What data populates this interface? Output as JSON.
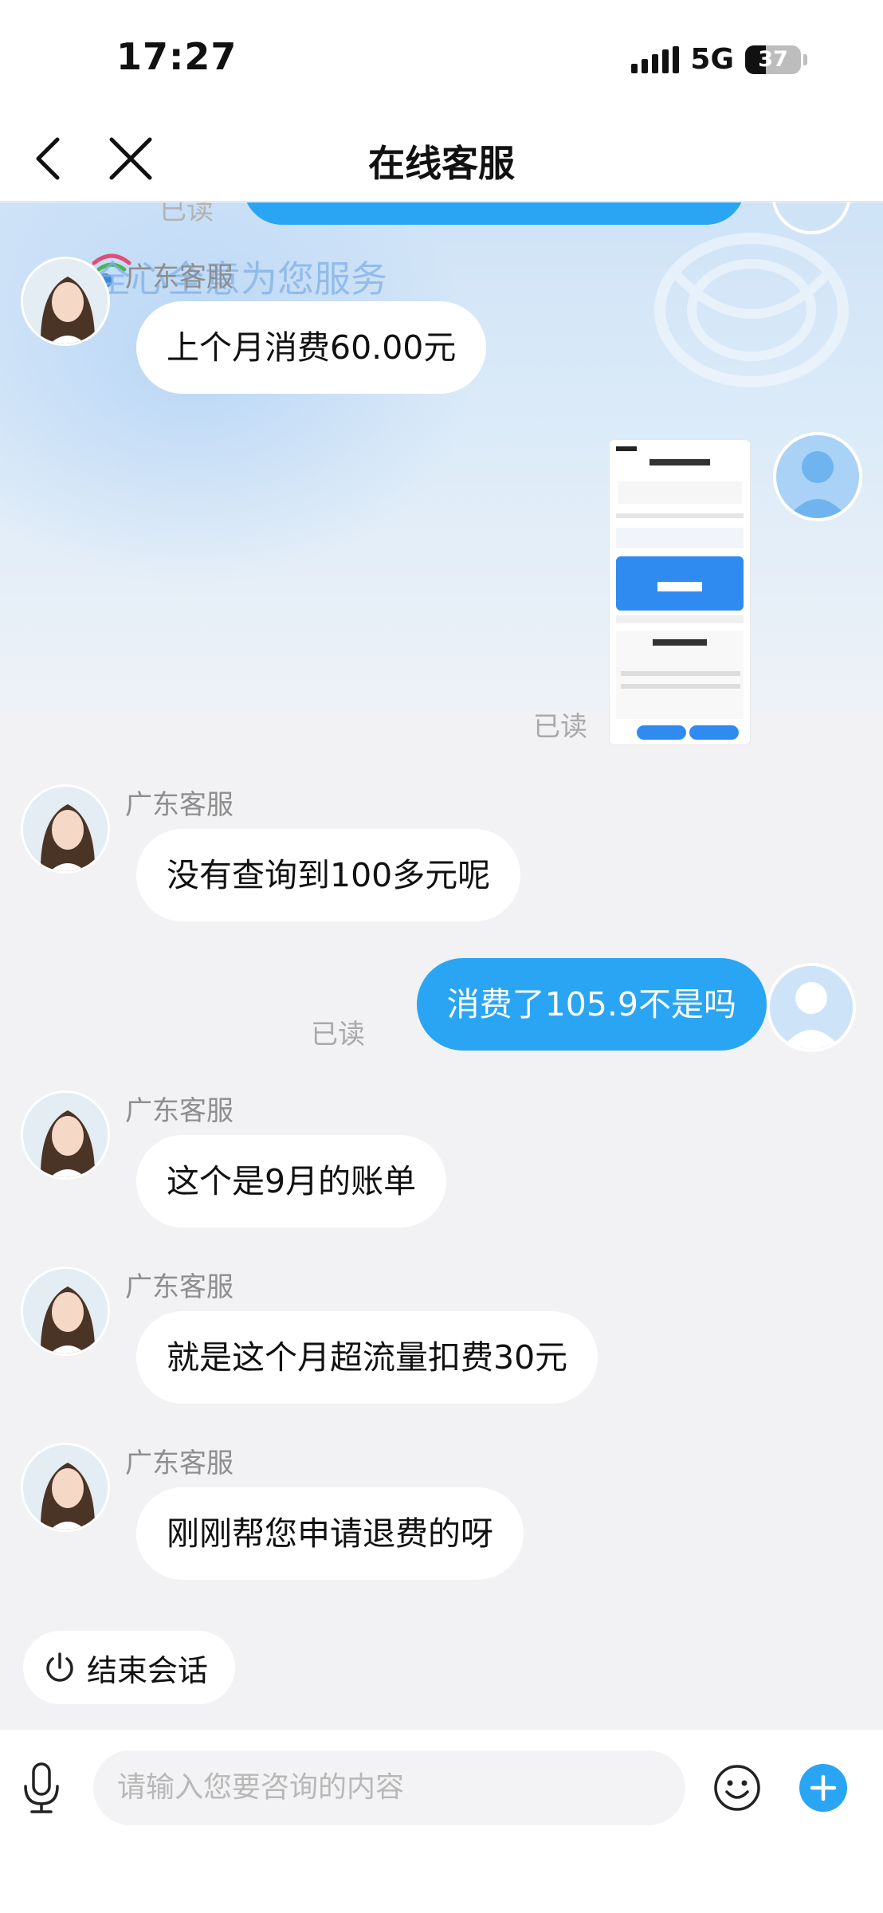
{
  "status_bar": {
    "time": "17:27",
    "network": "5G",
    "battery": "37",
    "battery_level": 0.37
  },
  "nav": {
    "title": "在线客服"
  },
  "banner": {
    "slogan": "全心全意为您服务"
  },
  "messages": [
    {
      "sender": "广东客服",
      "text": "上个月消费60.00元"
    },
    {
      "status": "已读"
    },
    {
      "sender": "广东客服",
      "text": "没有查询到100多元呢"
    },
    {
      "text": "消费了105.9不是吗",
      "status": "已读"
    },
    {
      "sender": "广东客服",
      "text": "这个是9月的账单"
    },
    {
      "sender": "广东客服",
      "text": "就是这个月超流量扣费30元"
    },
    {
      "sender": "广东客服",
      "text": "刚刚帮您申请退费的呀"
    }
  ],
  "previous_status": "已读",
  "end_session": {
    "label": "结束会话"
  },
  "input": {
    "placeholder": "请输入您要咨询的内容"
  },
  "colors": {
    "user_bubble": "#2aa5f3",
    "agent_bubble": "#ffffff",
    "background": "#f2f2f4"
  },
  "icons": [
    "back-icon",
    "close-icon",
    "microphone-icon",
    "emoji-icon",
    "plus-icon",
    "power-icon"
  ]
}
